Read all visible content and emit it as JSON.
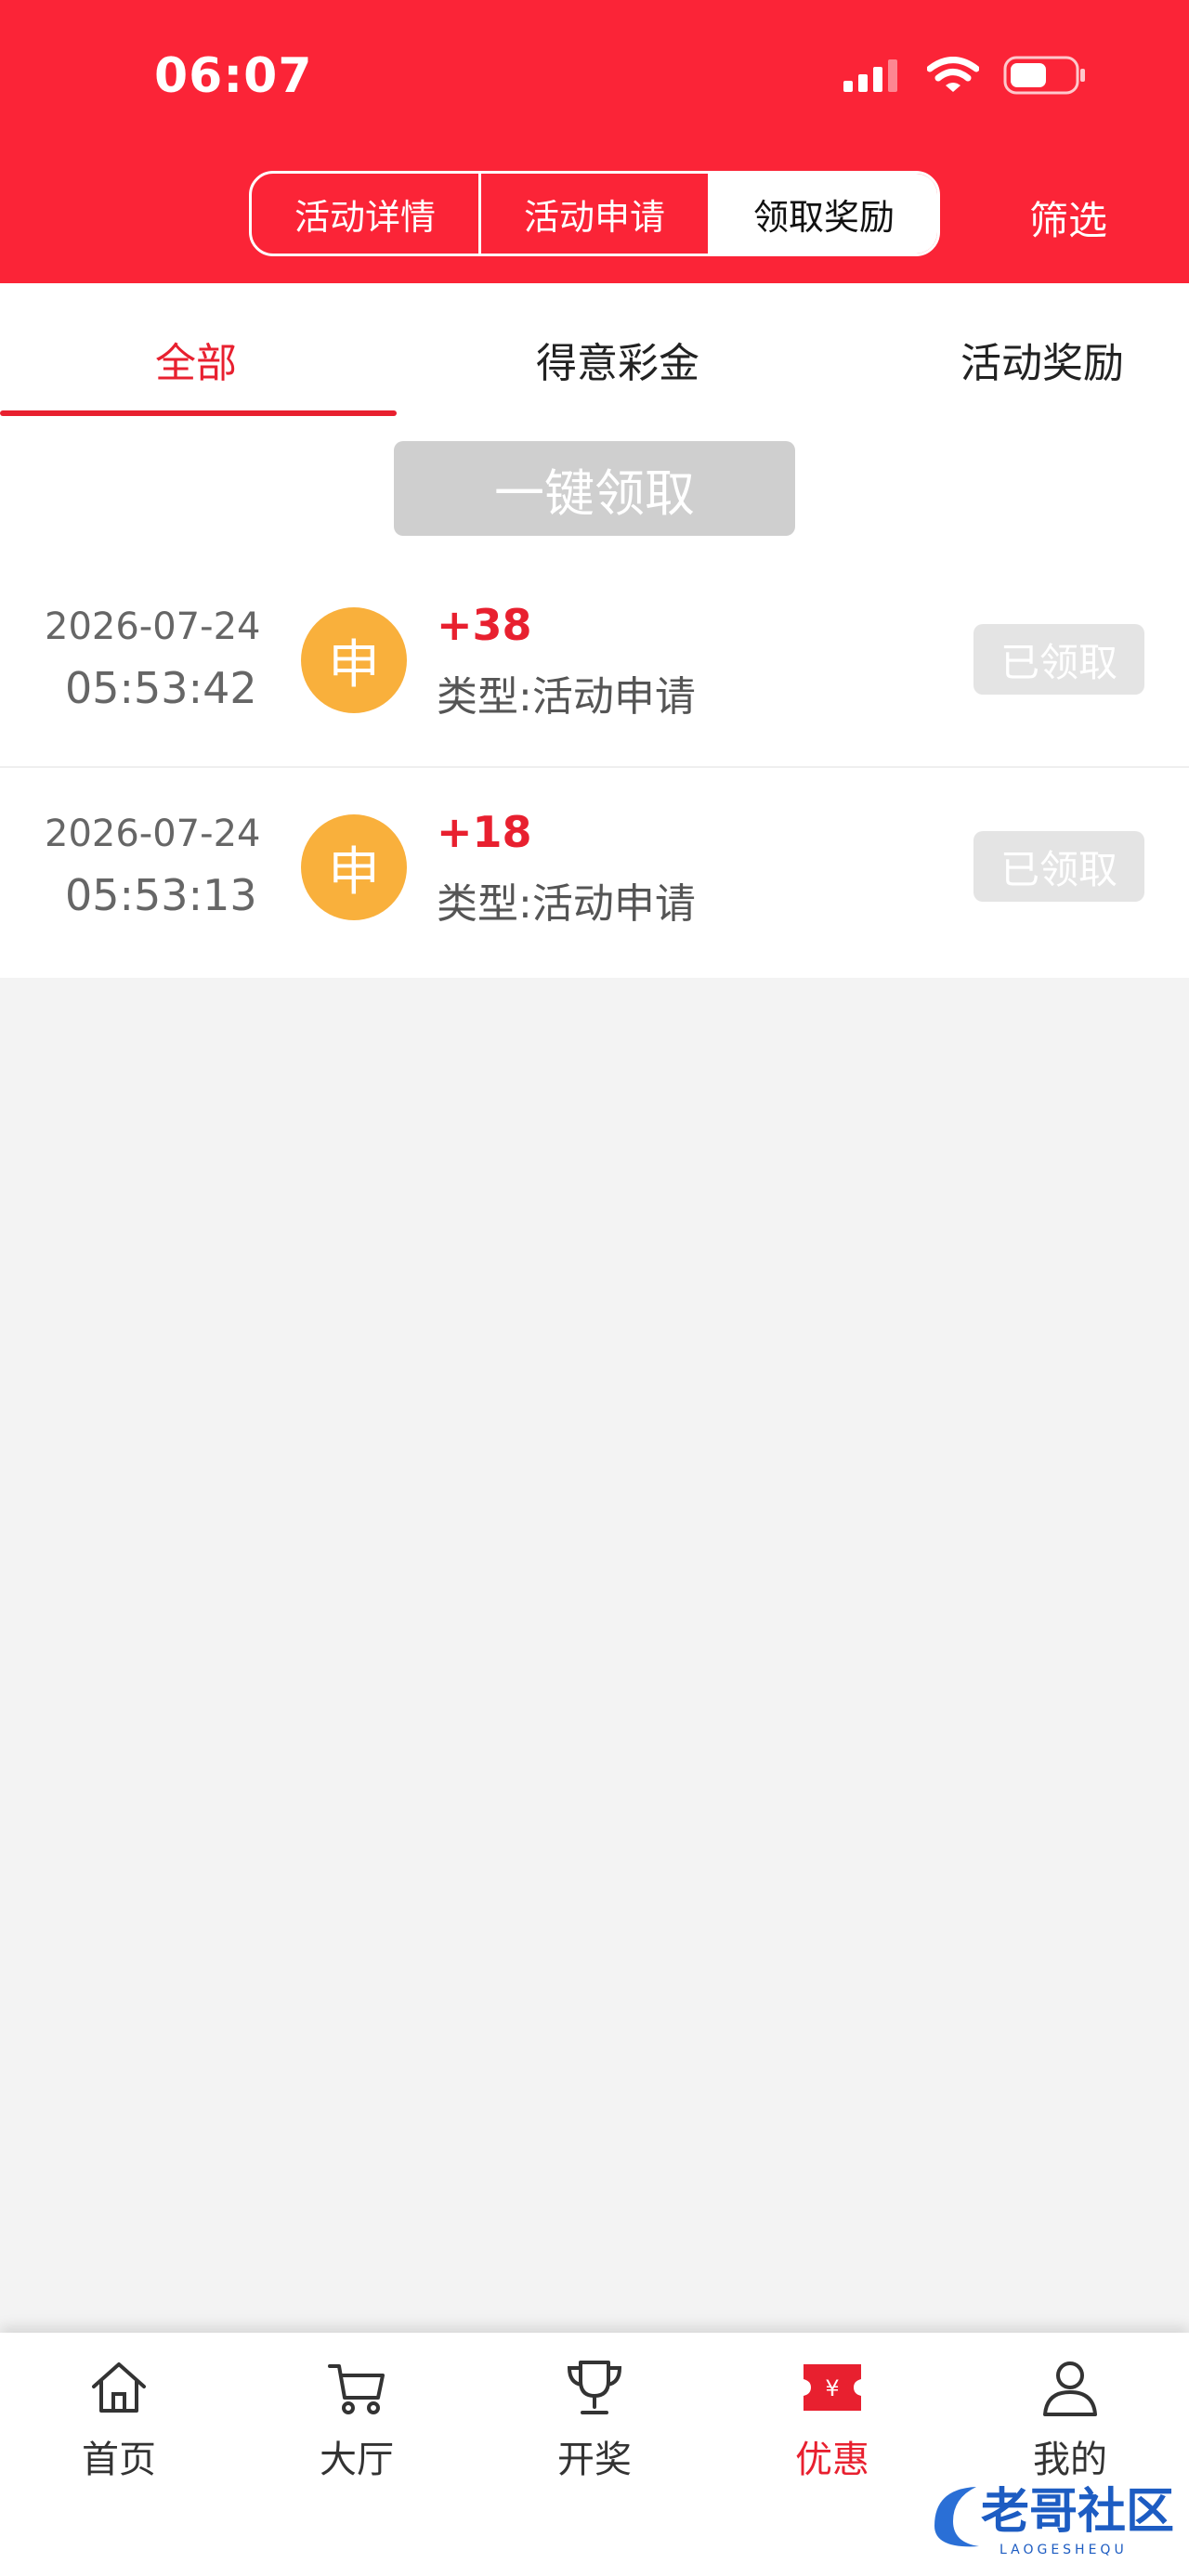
{
  "status_bar": {
    "time": "06:07"
  },
  "header": {
    "segments": [
      {
        "label": "活动详情",
        "active": false
      },
      {
        "label": "活动申请",
        "active": false
      },
      {
        "label": "领取奖励",
        "active": true
      }
    ],
    "filter_label": "筛选"
  },
  "subtabs": [
    {
      "label": "全部",
      "active": true
    },
    {
      "label": "得意彩金",
      "active": false
    },
    {
      "label": "活动奖励",
      "active": false
    }
  ],
  "claim_all_label": "一键领取",
  "records": [
    {
      "date": "2026-07-24",
      "time": "05:53:42",
      "badge": "申",
      "amount": "+38",
      "type": "类型:活动申请",
      "status": "已领取"
    },
    {
      "date": "2026-07-24",
      "time": "05:53:13",
      "badge": "申",
      "amount": "+18",
      "type": "类型:活动申请",
      "status": "已领取"
    }
  ],
  "bottom_nav": [
    {
      "label": "首页",
      "icon": "home-icon",
      "active": false
    },
    {
      "label": "大厅",
      "icon": "cart-icon",
      "active": false
    },
    {
      "label": "开奖",
      "icon": "trophy-icon",
      "active": false
    },
    {
      "label": "优惠",
      "icon": "coupon-icon",
      "active": true
    },
    {
      "label": "我的",
      "icon": "user-icon",
      "active": false
    }
  ],
  "watermark": {
    "text": "老哥社区",
    "subtext": "LAOGESHEQU"
  },
  "colors": {
    "brand_red": "#fb2437",
    "accent_red": "#e8202f",
    "badge_orange": "#f9b03c",
    "page_bg": "#f3f3f3"
  }
}
